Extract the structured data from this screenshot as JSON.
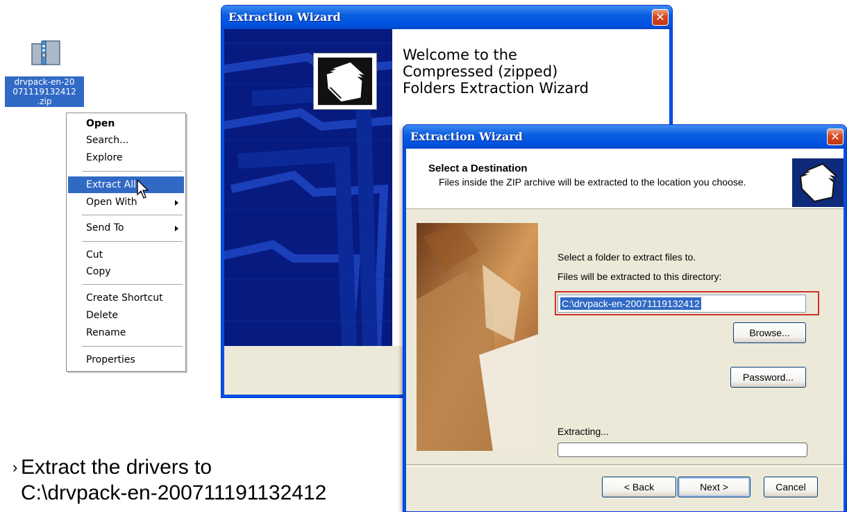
{
  "desktop": {
    "zip_icon": "zip-folder-icon",
    "zip_label_lines": [
      "drvpack-en-20",
      "071119132412",
      ".zip"
    ]
  },
  "context_menu": {
    "items": [
      {
        "label": "Open",
        "bold": true,
        "highlighted": false,
        "submenu": false
      },
      {
        "label": "Search...",
        "bold": false,
        "highlighted": false,
        "submenu": false
      },
      {
        "label": "Explore",
        "bold": false,
        "highlighted": false,
        "submenu": false
      },
      {
        "label": "Extract All...",
        "bold": false,
        "highlighted": true,
        "submenu": false
      },
      {
        "label": "Open With",
        "bold": false,
        "highlighted": false,
        "submenu": true
      },
      {
        "label": "Send To",
        "bold": false,
        "highlighted": false,
        "submenu": true
      },
      {
        "label": "Cut",
        "bold": false,
        "highlighted": false,
        "submenu": false
      },
      {
        "label": "Copy",
        "bold": false,
        "highlighted": false,
        "submenu": false
      },
      {
        "label": "Create Shortcut",
        "bold": false,
        "highlighted": false,
        "submenu": false
      },
      {
        "label": "Delete",
        "bold": false,
        "highlighted": false,
        "submenu": false
      },
      {
        "label": "Rename",
        "bold": false,
        "highlighted": false,
        "submenu": false
      },
      {
        "label": "Properties",
        "bold": false,
        "highlighted": false,
        "submenu": false
      }
    ],
    "highlight_color": "#316ac5"
  },
  "wizard_welcome": {
    "title": "Extraction Wizard",
    "close_symbol": "✕",
    "welcome_text": "Welcome to the Compressed (zipped) Folders Extraction Wizard",
    "icon": "folders-icon"
  },
  "wizard_destination": {
    "title": "Extraction Wizard",
    "close_symbol": "✕",
    "header_title": "Select a Destination",
    "header_subtitle": "Files inside the ZIP archive will be extracted to the location you choose.",
    "header_icon": "folders-icon",
    "select_folder_label": "Select a folder to extract files to.",
    "directory_label": "Files will be extracted to this directory:",
    "directory_value": "C:\\drvpack-en-20071119132412",
    "browse_button": "Browse...",
    "password_button": "Password...",
    "extracting_label": "Extracting...",
    "progress_fraction": 0.0,
    "back_button": "< Back",
    "next_button": "Next >",
    "cancel_button": "Cancel",
    "highlight_box_color": "#d0302c"
  },
  "caption": {
    "bullet": "›",
    "line1": "Extract the drivers to",
    "line2": "C:\\drvpack-en-200711191132412"
  }
}
